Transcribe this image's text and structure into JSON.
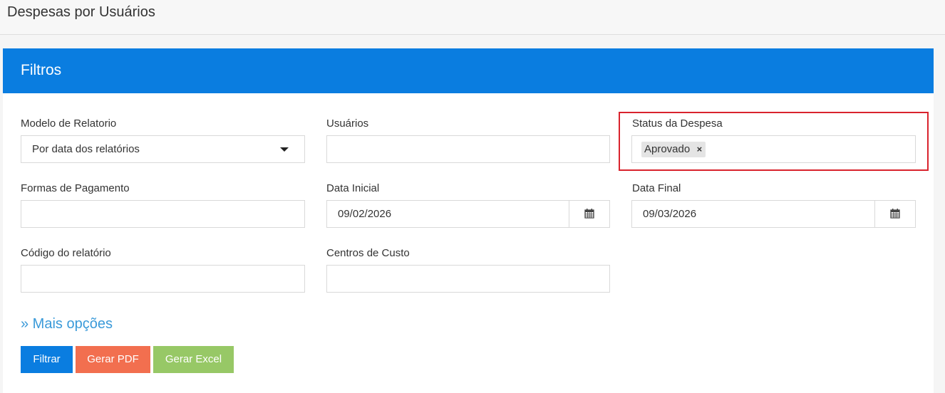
{
  "page": {
    "title": "Despesas por Usuários"
  },
  "panel": {
    "title": "Filtros"
  },
  "fields": {
    "modelo": {
      "label": "Modelo de Relatorio",
      "value": "Por data dos relatórios"
    },
    "usuarios": {
      "label": "Usuários",
      "value": ""
    },
    "status": {
      "label": "Status da Despesa",
      "tags": [
        "Aprovado"
      ],
      "tag_remove": "×"
    },
    "formas": {
      "label": "Formas de Pagamento",
      "value": ""
    },
    "data_inicial": {
      "label": "Data Inicial",
      "value": "09/02/2026",
      "icon": "calendar-icon"
    },
    "data_final": {
      "label": "Data Final",
      "value": "09/03/2026",
      "icon": "calendar-icon"
    },
    "codigo": {
      "label": "Código do relatório",
      "value": ""
    },
    "centros": {
      "label": "Centros de Custo",
      "value": ""
    }
  },
  "more_options": "» Mais opções",
  "buttons": {
    "filtrar": "Filtrar",
    "gerar_pdf": "Gerar PDF",
    "gerar_excel": "Gerar Excel"
  },
  "colors": {
    "header_blue": "#0a7de0",
    "btn_filtrar": "#0a7de0",
    "btn_pdf": "#f26f4f",
    "btn_excel": "#97c866",
    "highlight": "#d9232d",
    "link": "#3a9ad9"
  }
}
